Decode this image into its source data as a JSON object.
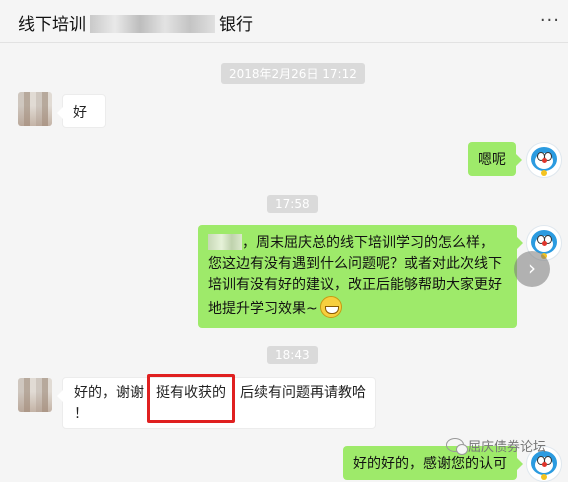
{
  "header": {
    "title_prefix": "线下培训",
    "title_suffix": "银行",
    "more_label": "···"
  },
  "messages": {
    "time1": "2018年2月26日 17:12",
    "m1": "好",
    "m2": "嗯呢",
    "time2": "17:58",
    "m3": "，周末屈庆总的线下培训学习的怎么样，您这边有没有遇到什么问题呢？或者对此次线下培训有没有好的建议，改正后能够帮助大家更好地提升学习效果~",
    "time3": "18:43",
    "m4_part1": "好的，谢谢",
    "m4_part2": "挺有收获的",
    "m4_part3": "后续有问题再请教哈",
    "m4_part4": "！",
    "m5": "好的好的，感谢您的认可"
  },
  "nav": {
    "next_label": "›"
  },
  "watermark": {
    "text": "屈庆债券论坛"
  },
  "icons": {
    "more": "more-icon",
    "next": "chevron-right-icon",
    "emoji": "grin-emoji-icon",
    "watermark": "wechat-icon"
  },
  "colors": {
    "bubble_right": "#9eea6a",
    "bubble_left": "#ffffff",
    "highlight": "#e02020",
    "background": "#f5f5f5"
  }
}
